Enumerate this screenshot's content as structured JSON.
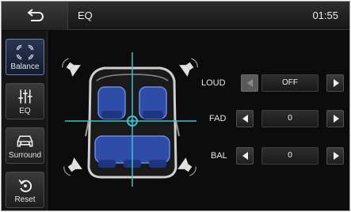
{
  "header": {
    "title": "EQ",
    "clock": "01:55"
  },
  "sidebar": {
    "items": [
      {
        "label_line1": "Balance",
        "icon": "balance-icon",
        "active": true
      },
      {
        "label_line1": "EQ",
        "icon": "eq-sliders-icon",
        "active": false
      },
      {
        "label_line1": "Surround",
        "icon": "car-icon",
        "active": false
      },
      {
        "label_line1": "Reset",
        "icon": "reset-icon",
        "active": false
      }
    ]
  },
  "controls": {
    "loud": {
      "label": "LOUD",
      "value": "OFF"
    },
    "fad": {
      "label": "FAD",
      "value": "0"
    },
    "bal": {
      "label": "BAL",
      "value": "0"
    }
  },
  "colors": {
    "accent": "#2aa7b8",
    "seat": "#2d4da8",
    "crosshair": "#3ec0d0"
  }
}
